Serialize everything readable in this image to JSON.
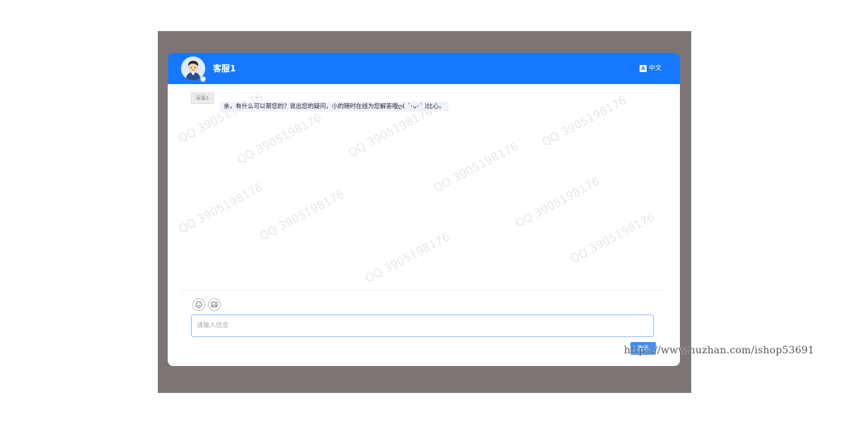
{
  "header": {
    "agent_name": "客服1",
    "language_label": "中文",
    "language_icon_text": "A",
    "brand_color": "#1677ff"
  },
  "messages": [
    {
      "sender": "客服1",
      "text": "亲，有什么可以帮您的？说出您的疑问，小的随时在线为您解答哦ღ( ´･ᴗ･` )比心。"
    }
  ],
  "watermark_text": "QQ 3905198176",
  "composer": {
    "emoji_icon": "emoji-icon",
    "image_icon": "image-icon",
    "placeholder": "请输入信息",
    "send_label": "发送"
  },
  "overlay_url": "https://www.huzhan.com/ishop53691"
}
